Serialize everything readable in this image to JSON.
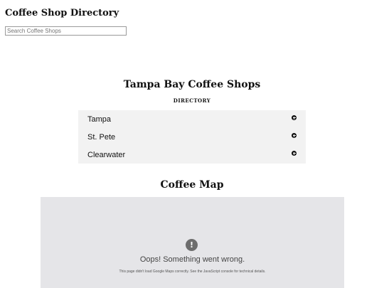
{
  "header": {
    "title": "Coffee Shop Directory",
    "search_placeholder": "Search Coffee Shops"
  },
  "directory": {
    "title": "Tampa Bay Coffee Shops",
    "subheading": "DIRECTORY",
    "items": [
      {
        "label": "Tampa",
        "icon": "plus-circle-icon"
      },
      {
        "label": "St. Pete",
        "icon": "plus-circle-icon"
      },
      {
        "label": "Clearwater",
        "icon": "plus-circle-icon"
      }
    ]
  },
  "map": {
    "title": "Coffee Map",
    "error_icon": "exclamation-circle-icon",
    "error_title": "Oops! Something went wrong.",
    "error_detail": "This page didn't load Google Maps correctly. See the JavaScript console for technical details."
  }
}
